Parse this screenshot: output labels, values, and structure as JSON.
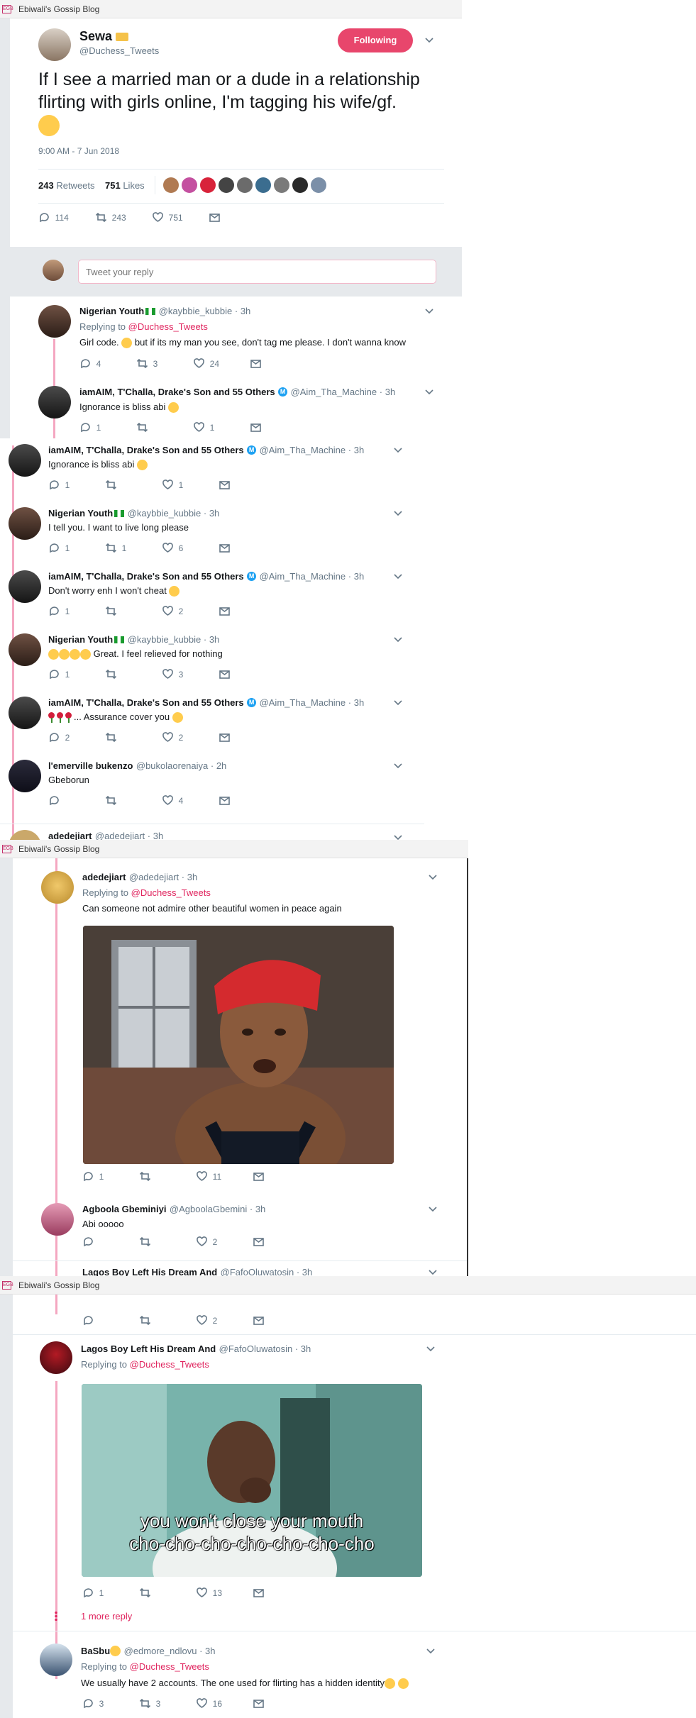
{
  "blog_title": "Ebiwali's Gossip Blog",
  "favicon_text": "EGB",
  "main_tweet": {
    "name": "Sewa",
    "handle": "@Duchess_Tweets",
    "follow_label": "Following",
    "text": "If I see a married man or a dude in a relationship flirting with girls online, I'm tagging his wife/gf.",
    "time": "9:00 AM - 7 Jun 2018",
    "retweets_count": "243",
    "retweets_label": "Retweets",
    "likes_count": "751",
    "likes_label": "Likes",
    "replies": "114",
    "rts": "243",
    "likes": "751"
  },
  "reply_placeholder": "Tweet your reply",
  "replying_to_label": "Replying to",
  "replying_to_handle": "@Duchess_Tweets",
  "more_reply": "1 more reply",
  "section1": [
    {
      "name": "Nigerian Youth",
      "handle": "@kaybbie_kubbie",
      "time": "3h",
      "replying": true,
      "text": "Girl code.  but if its my man you see, don't tag me please. I don't wanna know",
      "r": "4",
      "rt": "3",
      "l": "24"
    },
    {
      "name": "iamAIM, T'Challa, Drake's Son and 55 Others",
      "handle": "@Aim_Tha_Machine",
      "time": "3h",
      "text": "Ignorance is bliss abi",
      "r": "1",
      "rt": "",
      "l": "1"
    }
  ],
  "section2": [
    {
      "name": "iamAIM, T'Challa, Drake's Son and 55 Others",
      "handle": "@Aim_Tha_Machine",
      "time": "3h",
      "text": "Ignorance is bliss abi",
      "r": "1",
      "rt": "",
      "l": "1"
    },
    {
      "name": "Nigerian Youth",
      "handle": "@kaybbie_kubbie",
      "time": "3h",
      "text": "I tell you. I want to live long please",
      "r": "1",
      "rt": "1",
      "l": "6"
    },
    {
      "name": "iamAIM, T'Challa, Drake's Son and 55 Others",
      "handle": "@Aim_Tha_Machine",
      "time": "3h",
      "text": "Don't worry enh I won't cheat",
      "r": "1",
      "rt": "",
      "l": "2"
    },
    {
      "name": "Nigerian Youth",
      "handle": "@kaybbie_kubbie",
      "time": "3h",
      "text": "Great. I feel relieved for nothing",
      "r": "1",
      "rt": "",
      "l": "3"
    },
    {
      "name": "iamAIM, T'Challa, Drake's Son and 55 Others",
      "handle": "@Aim_Tha_Machine",
      "time": "3h",
      "text": "... Assurance cover you",
      "r": "2",
      "rt": "",
      "l": "2"
    },
    {
      "name": "l'emerville bukenzo",
      "handle": "@bukolaorenaiya",
      "time": "2h",
      "text": "Gbeborun",
      "r": "",
      "rt": "",
      "l": "4"
    },
    {
      "name": "adedejiart",
      "handle": "@adedejiart",
      "time": "3h"
    }
  ],
  "section3": [
    {
      "name": "adedejiart",
      "handle": "@adedejiart",
      "time": "3h",
      "text": "Can someone not admire other beautiful women in peace again",
      "r": "1",
      "rt": "",
      "l": "11"
    },
    {
      "name": "Agboola Gbeminiyi",
      "handle": "@AgboolaGbemini",
      "time": "3h",
      "text": "Abi ooooo",
      "r": "",
      "rt": "",
      "l": "2"
    },
    {
      "name": "Lagos Boy Left His Dream And",
      "handle": "@FafoOluwatosin",
      "time": "3h"
    }
  ],
  "section4": {
    "top_actions": {
      "r": "",
      "rt": "",
      "l": "2"
    },
    "tweets": [
      {
        "name": "Lagos Boy Left His Dream And",
        "handle": "@FafoOluwatosin",
        "time": "3h",
        "gif_caption_1": "you won't close your mouth",
        "gif_caption_2": "cho-cho-cho-cho-cho-cho-cho",
        "r": "1",
        "rt": "",
        "l": "13"
      },
      {
        "name": "BaSbu",
        "handle": "@edmore_ndlovu",
        "time": "3h",
        "text": "We usually have 2 accounts. The one used for flirting has a hidden identity",
        "r": "3",
        "rt": "3",
        "l": "16"
      }
    ]
  },
  "colors": {
    "accent": "#e0245e",
    "thread": "#f4a7c1",
    "follow_button": "#e8466c",
    "muted": "#657786"
  }
}
